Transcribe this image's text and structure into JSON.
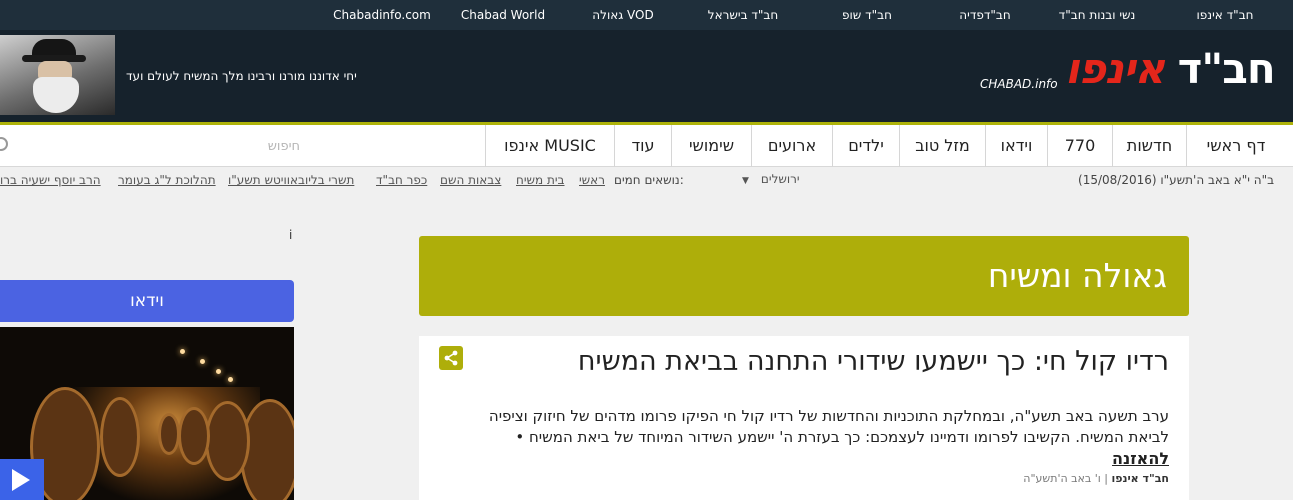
{
  "top_nav": {
    "items": [
      "חב\"ד אינפו",
      "נשי ובנות חב\"ד",
      "חב\"דפדיה",
      "חב\"ד שופ",
      "חב\"ד בישראל",
      "גאולה VOD",
      "Chabad World",
      "Chabadinfo.com"
    ]
  },
  "header": {
    "slogan": "יחי אדוננו מורנו ורבינו מלך המשיח לעולם ועד",
    "logo_text_a": "חב\"ד ",
    "logo_text_b": "אינפו",
    "logo_sub": "CHABAD.info"
  },
  "main_nav": {
    "items": [
      "דף ראשי",
      "חדשות",
      "770",
      "וידאו",
      "מזל טוב",
      "ילדים",
      "ארועים",
      "שימושי",
      "עוד",
      "אינפו MUSIC"
    ],
    "search_placeholder": "חיפוש"
  },
  "sub_bar": {
    "date": "ב\"ה י\"א באב ה'תשע\"ו (15/08/2016)",
    "city": "ירושלים",
    "hot_topics_label": "נושאים חמים:",
    "tags": [
      "ראשי",
      "בית משיח",
      "צבאות השם",
      "כפר חב\"ד",
      "תשרי בליובאוויטש תשע\"ו",
      "תהלוכת ל\"ג בעומר",
      "הרב יוסף ישעיה ברו"
    ]
  },
  "sidebar": {
    "info_mark": "i",
    "video_label": "וידאו"
  },
  "category": {
    "title": "גאולה ומשיח"
  },
  "article": {
    "title": "רדיו קול חי: כך יישמעו שידורי התחנה בביאת המשיח",
    "body": "ערב תשעה באב תשע\"ה, ובמחלקת התוכניות והחדשות של רדיו קול חי הפיקו פרומו מדהים של חיזוק וציפיה לביאת המשיח. הקשיבו לפרומו ודמיינו לעצמכם: כך בעזרת ה' יישמע השידור המיוחד של ביאת המשיח •",
    "listen_link": "להאזנה",
    "meta_source": "חב\"ד אינפו",
    "meta_date": "ו' באב ה'תשע\"ה"
  },
  "colors": {
    "topbar_bg": "#1f2f3b",
    "header_bg": "#16222c",
    "accent_olive": "#aeae0a",
    "logo_red": "#e4261b",
    "video_blue": "#4b63e2"
  }
}
